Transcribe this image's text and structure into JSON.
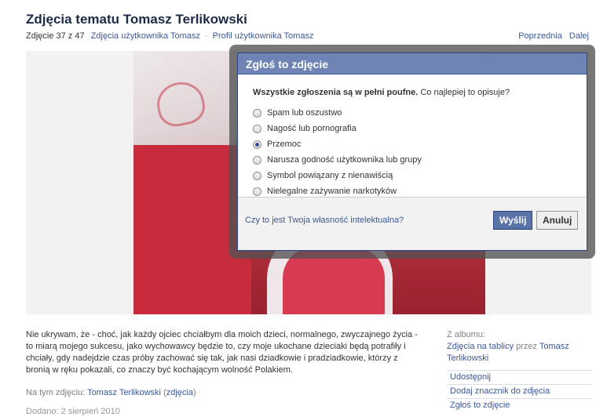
{
  "page": {
    "title": "Zdjęcia tematu Tomasz Terlikowski",
    "counter": "Zdjęcie 37 z 47",
    "user_photos_link": "Zdjęcia użytkownika Tomasz",
    "separator": "·",
    "profile_link": "Profil użytkownika Tomasz",
    "prev": "Poprzednia",
    "next": "Dalej"
  },
  "description": "Nie ukrywam, że - choć, jak każdy ojciec chciałbym dla moich dzieci, normalnego, zwyczajnego życia - to miarą mojego sukcesu, jako wychowawcy będzie to, czy moje ukochane dzieciaki będą potrafiły i chciały, gdy nadejdzie czas próby zachować się tak, jak nasi dziadkowie i pradziadkowie, którzy z bronią w ręku pokazali, co znaczy być kochającym wolność Polakiem.",
  "tagged": {
    "label": "Na tym zdjęciu:",
    "person": "Tomasz Terlikowski",
    "open": "(",
    "photos": "zdjęcia",
    "close": ")"
  },
  "added": "Dodano: 2 sierpień 2010",
  "album": {
    "label": "Z albumu:",
    "name": "Zdjęcia na tablicy",
    "by": "przez",
    "owner": "Tomasz Terlikowski"
  },
  "actions": [
    "Udostępnij",
    "Dodaj znacznik do zdjęcia",
    "Zgłoś to zdjęcie"
  ],
  "dialog": {
    "title": "Zgłoś to zdjęcie",
    "prompt_bold": "Wszystkie zgłoszenia są w pełni poufne.",
    "prompt_rest": "Co najlepiej to opisuje?",
    "options": [
      {
        "label": "Spam lub oszustwo",
        "checked": false
      },
      {
        "label": "Nagość lub pornografia",
        "checked": false
      },
      {
        "label": "Przemoc",
        "checked": true
      },
      {
        "label": "Narusza godność użytkownika lub grupy",
        "checked": false
      },
      {
        "label": "Symbol powiązany z nienawiścią",
        "checked": false
      },
      {
        "label": "Nielegalne zażywanie narkotyków",
        "checked": false
      }
    ],
    "ip_link": "Czy to jest Twoja własność intelektualna?",
    "send": "Wyślij",
    "cancel": "Anuluj"
  },
  "colors": {
    "link": "#3b5998",
    "dialog_header": "#6d84b4",
    "send_button": "#5b74a8"
  }
}
